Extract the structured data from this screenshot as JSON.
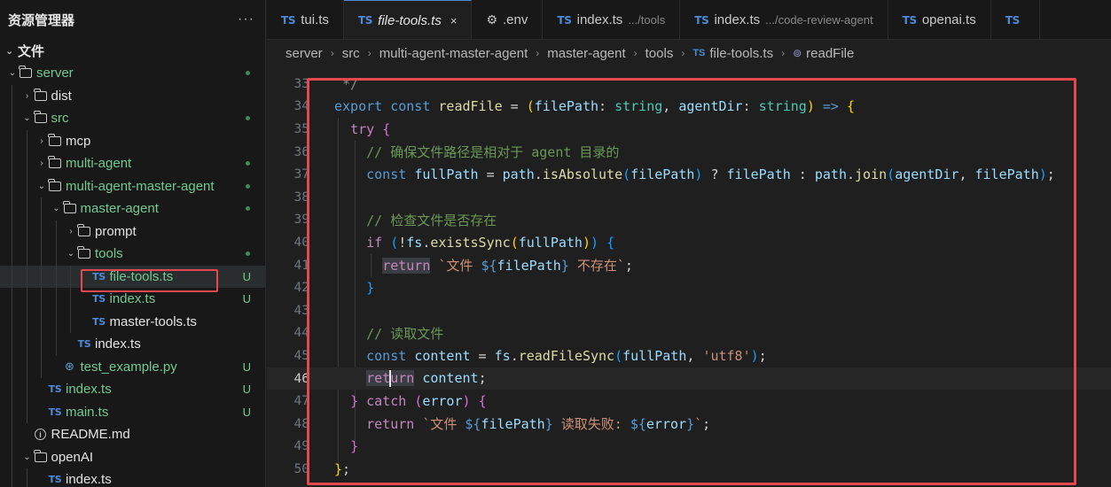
{
  "sidebar": {
    "title": "资源管理器",
    "more": "···",
    "section": "文件",
    "items": [
      {
        "label": "server",
        "kind": "folder",
        "open": true,
        "color": "green",
        "status": "dot"
      },
      {
        "label": "dist",
        "kind": "folder",
        "open": false,
        "color": "white",
        "status": ""
      },
      {
        "label": "src",
        "kind": "folder",
        "open": true,
        "color": "green",
        "status": "dot"
      },
      {
        "label": "mcp",
        "kind": "folder",
        "open": false,
        "color": "white",
        "status": ""
      },
      {
        "label": "multi-agent",
        "kind": "folder",
        "open": false,
        "color": "green",
        "status": "dot"
      },
      {
        "label": "multi-agent-master-agent",
        "kind": "folder",
        "open": true,
        "color": "green",
        "status": "dot"
      },
      {
        "label": "master-agent",
        "kind": "folder",
        "open": true,
        "color": "green",
        "status": "dot"
      },
      {
        "label": "prompt",
        "kind": "folder",
        "open": false,
        "color": "white",
        "status": ""
      },
      {
        "label": "tools",
        "kind": "folder",
        "open": true,
        "color": "green",
        "status": "dot"
      },
      {
        "label": "file-tools.ts",
        "kind": "ts",
        "color": "green",
        "status": "U",
        "selected": true
      },
      {
        "label": "index.ts",
        "kind": "ts",
        "color": "green",
        "status": "U"
      },
      {
        "label": "master-tools.ts",
        "kind": "ts",
        "color": "white",
        "status": ""
      },
      {
        "label": "index.ts",
        "kind": "ts",
        "color": "white",
        "status": ""
      },
      {
        "label": "test_example.py",
        "kind": "py",
        "color": "green",
        "status": "U"
      },
      {
        "label": "index.ts",
        "kind": "ts",
        "color": "green",
        "status": "U"
      },
      {
        "label": "main.ts",
        "kind": "ts",
        "color": "green",
        "status": "U"
      },
      {
        "label": "README.md",
        "kind": "info",
        "color": "white",
        "status": ""
      },
      {
        "label": "openAI",
        "kind": "folder",
        "open": true,
        "color": "white",
        "status": ""
      },
      {
        "label": "index.ts",
        "kind": "ts",
        "color": "white",
        "status": ""
      }
    ]
  },
  "tabs": [
    {
      "label": "tui.ts",
      "icon": "ts",
      "hint": ""
    },
    {
      "label": "file-tools.ts",
      "icon": "ts",
      "hint": "",
      "active": true,
      "close": "×"
    },
    {
      "label": ".env",
      "icon": "gear",
      "hint": ""
    },
    {
      "label": "index.ts",
      "icon": "ts",
      "hint": ".../tools"
    },
    {
      "label": "index.ts",
      "icon": "ts",
      "hint": ".../code-review-agent"
    },
    {
      "label": "openai.ts",
      "icon": "ts",
      "hint": ""
    },
    {
      "label": "",
      "icon": "ts",
      "hint": ""
    }
  ],
  "breadcrumb": [
    "server",
    "src",
    "multi-agent-master-agent",
    "master-agent",
    "tools",
    "file-tools.ts",
    "readFile"
  ],
  "icons": {
    "ts": "TS",
    "chevron_open": "⌄",
    "chevron_closed": "›",
    "fn": "⊚",
    "gear": "⚙",
    "py": "⊛",
    "info": "i"
  },
  "editor": {
    "current_line": 46,
    "lines": [
      {
        "n": "33",
        "html": "<span class='cm-grey'> */</span>"
      },
      {
        "n": "34",
        "html": "<span class='kw'>export</span> <span class='kw'>const</span> <span class='fn'>readFile</span> = <span class='br1'>(</span><span class='var'>filePath</span>: <span class='ty'>string</span>, <span class='var'>agentDir</span>: <span class='ty'>string</span><span class='br1'>)</span> <span class='kw'>=&gt;</span> <span class='br1'>{</span>"
      },
      {
        "n": "35",
        "html": "  <span class='kw2'>try</span> <span class='br2'>{</span>"
      },
      {
        "n": "36",
        "html": "    <span class='cm'>// 确保文件路径是相对于 agent 目录的</span>"
      },
      {
        "n": "37",
        "html": "    <span class='kw'>const</span> <span class='var'>fullPath</span> = <span class='var'>path</span>.<span class='fn'>isAbsolute</span><span class='br3'>(</span><span class='var'>filePath</span><span class='br3'>)</span> ? <span class='var'>filePath</span> : <span class='var'>path</span>.<span class='fn'>join</span><span class='br3'>(</span><span class='var'>agentDir</span>, <span class='var'>filePath</span><span class='br3'>)</span>;"
      },
      {
        "n": "38",
        "html": ""
      },
      {
        "n": "39",
        "html": "    <span class='cm'>// 检查文件是否存在</span>"
      },
      {
        "n": "40",
        "html": "    <span class='kw2'>if</span> <span class='br3'>(</span>!<span class='var'>fs</span>.<span class='fn'>existsSync</span><span class='br1'>(</span><span class='var'>fullPath</span><span class='br1'>)</span><span class='br3'>)</span> <span class='br3'>{</span>"
      },
      {
        "n": "41",
        "html": "      <span class='kw2 hl'>return</span> <span class='str'>`文件 </span><span class='kw'>${</span><span class='var'>filePath</span><span class='kw'>}</span><span class='str'> 不存在`</span>;"
      },
      {
        "n": "42",
        "html": "    <span class='br3'>}</span>"
      },
      {
        "n": "43",
        "html": ""
      },
      {
        "n": "44",
        "html": "    <span class='cm'>// 读取文件</span>"
      },
      {
        "n": "45",
        "html": "    <span class='kw'>const</span> <span class='var'>content</span> = <span class='var'>fs</span>.<span class='fn'>readFileSync</span><span class='br3'>(</span><span class='var'>fullPath</span>, <span class='str'>'utf8'</span><span class='br3'>)</span>;"
      },
      {
        "n": "46",
        "html": "    <span class='kw2 hl'>ret<span class='cursor'></span>urn</span> <span class='var'>content</span>;"
      },
      {
        "n": "47",
        "html": "  <span class='br2'>}</span> <span class='kw2'>catch</span> <span class='br2'>(</span><span class='var'>error</span><span class='br2'>)</span> <span class='br2'>{</span>"
      },
      {
        "n": "48",
        "html": "    <span class='kw2'>return</span> <span class='str'>`文件 </span><span class='kw'>${</span><span class='var'>filePath</span><span class='kw'>}</span><span class='str'> 读取失败: </span><span class='kw'>${</span><span class='var'>error</span><span class='kw'>}</span><span class='str'>`</span>;"
      },
      {
        "n": "49",
        "html": "  <span class='br2'>}</span>"
      },
      {
        "n": "50",
        "html": "<span class='br1'>}</span>;"
      }
    ]
  }
}
